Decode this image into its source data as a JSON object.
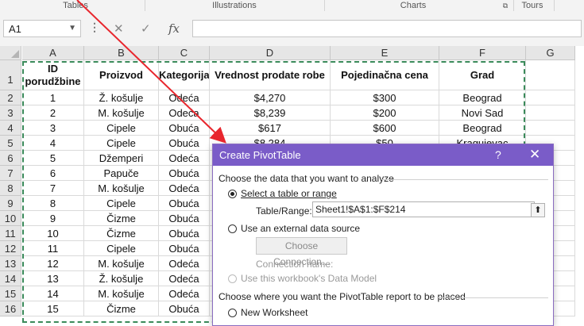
{
  "ribbon": {
    "groups": [
      "Tables",
      "Illustrations",
      "Charts",
      "Tours"
    ]
  },
  "formula_bar": {
    "name_box": "A1",
    "cancel_icon": "✕",
    "enter_icon": "✓",
    "fx_label": "fx",
    "value": ""
  },
  "sheet": {
    "columns": [
      "A",
      "B",
      "C",
      "D",
      "E",
      "F",
      "G"
    ],
    "rows": [
      "1",
      "2",
      "3",
      "4",
      "5",
      "6",
      "7",
      "8",
      "9",
      "10",
      "11",
      "12",
      "13",
      "14",
      "15",
      "16"
    ],
    "header": [
      "ID porudžbine",
      "Proizvod",
      "Kategorija",
      "Vrednost prodate robe",
      "Pojedinačna cena",
      "Grad"
    ],
    "data": [
      [
        "1",
        "Ž. košulje",
        "Odeća",
        "$4,270",
        "$300",
        "Beograd"
      ],
      [
        "2",
        "M. košulje",
        "Odeća",
        "$8,239",
        "$200",
        "Novi Sad"
      ],
      [
        "3",
        "Cipele",
        "Obuća",
        "$617",
        "$600",
        "Beograd"
      ],
      [
        "4",
        "Cipele",
        "Obuća",
        "$8,284",
        "$50",
        "Kragujevac"
      ],
      [
        "5",
        "Džemperi",
        "Odeća",
        "",
        "",
        ""
      ],
      [
        "6",
        "Papuče",
        "Obuća",
        "",
        "",
        ""
      ],
      [
        "7",
        "M. košulje",
        "Odeća",
        "",
        "",
        ""
      ],
      [
        "8",
        "Cipele",
        "Obuća",
        "",
        "",
        ""
      ],
      [
        "9",
        "Čizme",
        "Obuća",
        "",
        "",
        ""
      ],
      [
        "10",
        "Čizme",
        "Obuća",
        "",
        "",
        ""
      ],
      [
        "11",
        "Cipele",
        "Obuća",
        "",
        "",
        ""
      ],
      [
        "12",
        "M. košulje",
        "Odeća",
        "",
        "",
        ""
      ],
      [
        "13",
        "Ž. košulje",
        "Odeća",
        "",
        "",
        ""
      ],
      [
        "14",
        "M. košulje",
        "Odeća",
        "",
        "",
        ""
      ],
      [
        "15",
        "Čizme",
        "Obuća",
        "",
        "",
        ""
      ]
    ]
  },
  "dialog": {
    "title": "Create PivotTable",
    "help": "?",
    "close": "✕",
    "section_choose_data": "Choose the data that you want to analyze",
    "option_select_range": "Select a table or range",
    "table_range_label": "Table/Range:",
    "table_range_value": "Sheet1!$A$1:$F$214",
    "collapse_icon": "⬆",
    "option_external": "Use an external data source",
    "choose_connection": "Choose Connection...",
    "connection_name_label": "Connection name:",
    "option_data_model": "Use this workbook's Data Model",
    "section_place": "Choose where you want the PivotTable report to be placed",
    "option_new_worksheet": "New Worksheet"
  },
  "colors": {
    "dialog_title_bg": "#7a5cc8",
    "arrow": "#e8262d",
    "marquee": "#3a8a5a"
  }
}
